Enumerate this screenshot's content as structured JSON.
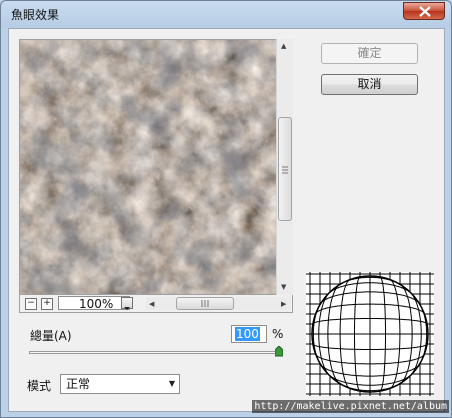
{
  "window": {
    "title": "魚眼效果",
    "close_icon": "close-icon"
  },
  "buttons": {
    "ok": "確定",
    "cancel": "取消"
  },
  "zoom": {
    "value": "100%",
    "minus": "−",
    "plus": "+"
  },
  "amount": {
    "label": "總量(A)",
    "value": "100",
    "unit": "%",
    "level": 1.0
  },
  "mode": {
    "label": "模式",
    "value": "正常"
  },
  "watermark": "http://makelive.pixnet.net/album",
  "colors": {
    "title_bar": "#bcd3ea",
    "close": "#c9503a",
    "selection": "#3399ff",
    "slider_thumb": "#3a9a3a"
  }
}
